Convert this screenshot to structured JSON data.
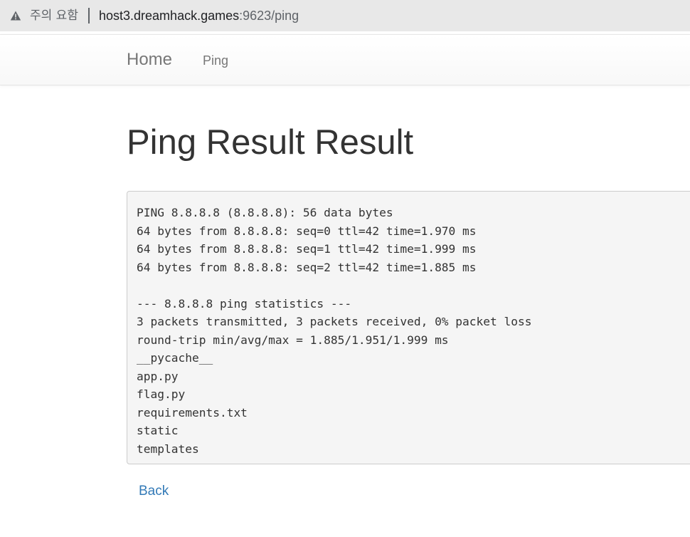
{
  "browser": {
    "security_label": "주의 요함",
    "url_host": "host3.dreamhack.games",
    "url_rest": ":9623/ping"
  },
  "navbar": {
    "brand": "Home",
    "links": [
      "Ping"
    ]
  },
  "main": {
    "title": "Ping Result Result",
    "result_lines": [
      "PING 8.8.8.8 (8.8.8.8): 56 data bytes",
      "64 bytes from 8.8.8.8: seq=0 ttl=42 time=1.970 ms",
      "64 bytes from 8.8.8.8: seq=1 ttl=42 time=1.999 ms",
      "64 bytes from 8.8.8.8: seq=2 ttl=42 time=1.885 ms",
      "",
      "--- 8.8.8.8 ping statistics ---",
      "3 packets transmitted, 3 packets received, 0% packet loss",
      "round-trip min/avg/max = 1.885/1.951/1.999 ms",
      "__pycache__",
      "app.py",
      "flag.py",
      "requirements.txt",
      "static",
      "templates"
    ],
    "back_label": "Back"
  },
  "icons": {
    "security": "warning-triangle-icon"
  },
  "colors": {
    "link": "#337ab7",
    "title": "#333333",
    "nav_text": "#777777",
    "pre_bg": "#f5f5f5"
  }
}
